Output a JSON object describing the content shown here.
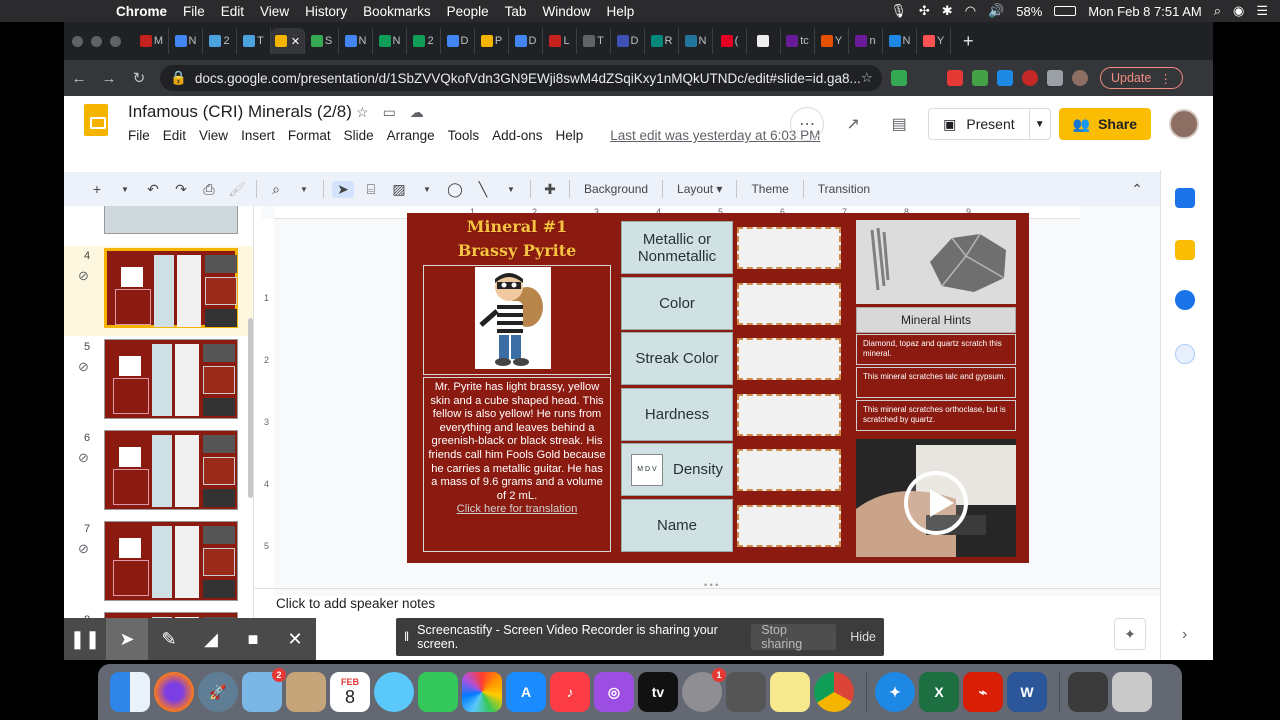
{
  "mac_menubar": {
    "app_name": "Chrome",
    "items": [
      "File",
      "Edit",
      "View",
      "History",
      "Bookmarks",
      "People",
      "Tab",
      "Window",
      "Help"
    ],
    "battery": "58%",
    "datetime": "Mon Feb 8  7:51 AM"
  },
  "browser": {
    "tabs": [
      {
        "label": "M",
        "color": "#c5221f"
      },
      {
        "label": "N",
        "color": "#4285f4"
      },
      {
        "label": "2",
        "color": "#4aa3df"
      },
      {
        "label": "T",
        "color": "#4aa3df"
      },
      {
        "label": "",
        "color": "#f4b400",
        "active": true
      },
      {
        "label": "S",
        "color": "#34a853"
      },
      {
        "label": "N",
        "color": "#4285f4"
      },
      {
        "label": "N",
        "color": "#0f9d58"
      },
      {
        "label": "2",
        "color": "#0f9d58"
      },
      {
        "label": "D",
        "color": "#4285f4"
      },
      {
        "label": "P",
        "color": "#f4b400"
      },
      {
        "label": "D",
        "color": "#4285f4"
      },
      {
        "label": "L",
        "color": "#c5221f"
      },
      {
        "label": "T",
        "color": "#5f6368"
      },
      {
        "label": "D",
        "color": "#3f51b5"
      },
      {
        "label": "R",
        "color": "#00897b"
      },
      {
        "label": "N",
        "color": "#21759b"
      },
      {
        "label": "(",
        "color": "#e60023"
      },
      {
        "label": "",
        "color": "#eeeeee"
      },
      {
        "label": "tc",
        "color": "#6a1b9a"
      },
      {
        "label": "Y",
        "color": "#e65100"
      },
      {
        "label": "n",
        "color": "#6a1b9a"
      },
      {
        "label": "N",
        "color": "#1e88e5"
      },
      {
        "label": "Y",
        "color": "#ff5252"
      }
    ],
    "new_tab": "+",
    "url": "docs.google.com/presentation/d/1SbZVVQkofVdn3GN9EWji8swM4dZSqiKxy1nMQkUTNDc/edit#slide=id.ga8...",
    "update_label": "Update"
  },
  "slides_app": {
    "title": "Infamous (CRI) Minerals (2/8)",
    "menu": [
      "File",
      "Edit",
      "View",
      "Insert",
      "Format",
      "Slide",
      "Arrange",
      "Tools",
      "Add-ons",
      "Help"
    ],
    "last_edit": "Last edit was yesterday at 6:03 PM",
    "present_label": "Present",
    "share_label": "Share",
    "toolbar": {
      "background": "Background",
      "layout": "Layout",
      "theme": "Theme",
      "transition": "Transition"
    },
    "notes_placeholder": "Click to add speaker notes",
    "thumbnails": [
      {
        "num": "4",
        "selected": true
      },
      {
        "num": "5",
        "selected": false
      },
      {
        "num": "6",
        "selected": false
      },
      {
        "num": "7",
        "selected": false
      },
      {
        "num": "8",
        "selected": false
      }
    ],
    "ruler_h": [
      "1",
      "2",
      "3",
      "4",
      "5",
      "6",
      "7",
      "8",
      "9"
    ],
    "ruler_v": [
      "1",
      "2",
      "3",
      "4",
      "5"
    ]
  },
  "slide": {
    "title_line1": "Mineral #1",
    "title_line2": "Brassy Pyrite",
    "description": "Mr. Pyrite has light brassy, yellow skin and a cube shaped head. This fellow is also yellow! He runs from everything and leaves behind a greenish-black or black streak. His friends call him Fools Gold because he carries a metallic guitar. He has a mass of 9.6 grams and a volume of 2 mL.",
    "link_text": "Click here for translation",
    "properties": [
      "Metallic or Nonmetallic",
      "Color",
      "Streak Color",
      "Hardness",
      "Density",
      "Name"
    ],
    "density_icon_text": "M D V",
    "hints_title": "Mineral Hints",
    "hints": [
      "Diamond, topaz and quartz scratch this mineral.",
      "This mineral scratches talc and gypsum.",
      "This mineral scratches orthoclase, but is scratched by quartz."
    ]
  },
  "screencastify": {
    "banner_text": "Screencastify - Screen Video Recorder is sharing your screen.",
    "stop_label": "Stop sharing",
    "hide_label": "Hide"
  },
  "dock": {
    "calendar_month": "FEB",
    "calendar_day": "8",
    "mail_badge": "2",
    "prefs_badge": "1",
    "appletv_label": "tv",
    "excel_label": "X",
    "word_label": "W"
  }
}
